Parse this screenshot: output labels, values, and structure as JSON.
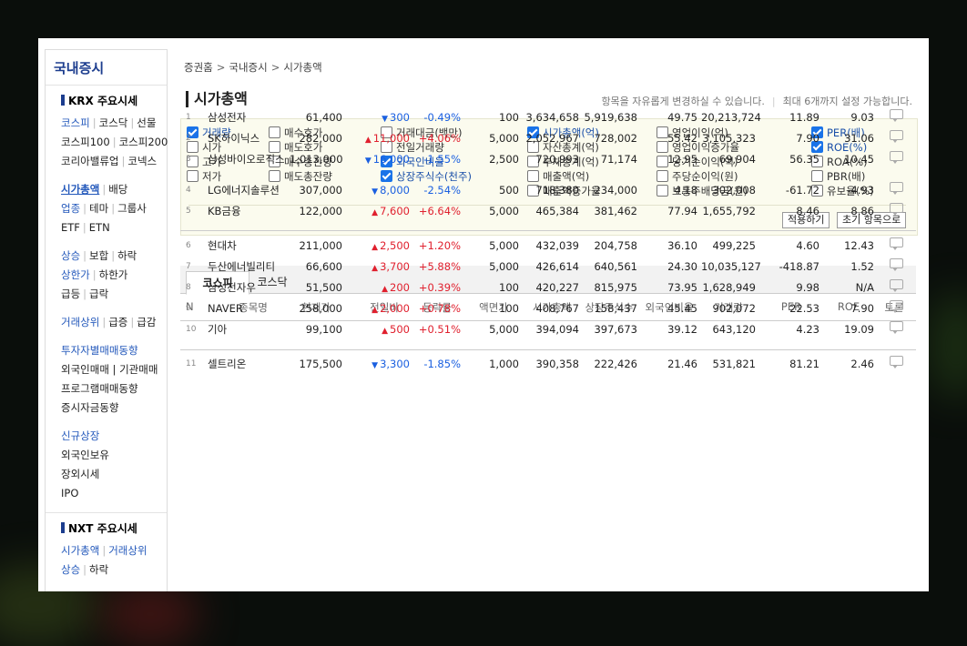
{
  "sidebar": {
    "title": "국내증시",
    "krx_head": "KRX 주요시세",
    "krx_rows": [
      [
        "코스피",
        "코스닥",
        "선물"
      ],
      [
        "코스피100",
        "코스피200"
      ],
      [
        "코리아밸류업",
        "코넥스"
      ]
    ],
    "group2": [
      [
        "시가총액",
        "배당"
      ],
      [
        "업종",
        "테마",
        "그룹사"
      ],
      [
        "ETF",
        "ETN"
      ]
    ],
    "group3": [
      [
        "상승",
        "보합",
        "하락"
      ],
      [
        "상한가",
        "하한가"
      ],
      [
        "급등",
        "급락"
      ]
    ],
    "group4": [
      [
        "거래상위",
        "급증",
        "급감"
      ]
    ],
    "group5": [
      "투자자별매매동향",
      "외국인매매 | 기관매매",
      "프로그램매매동향",
      "증시자금동향"
    ],
    "group6": [
      "신규상장",
      "외국인보유",
      "장외시세",
      "IPO"
    ],
    "nxt_head": "NXT 주요시세",
    "nxt_rows": [
      [
        "시가총액",
        "거래상위"
      ],
      [
        "상승",
        "하락"
      ]
    ]
  },
  "breadcrumb": [
    "증권홈",
    "국내증시",
    "시가총액"
  ],
  "page_title": "시가총액",
  "note_left": "항목을 자유롭게 변경하실 수 있습니다.",
  "note_right": "최대 6개까지 설정 가능합니다.",
  "options": [
    {
      "label": "거래량",
      "checked": true
    },
    {
      "label": "시가",
      "checked": false
    },
    {
      "label": "고가",
      "checked": false
    },
    {
      "label": "저가",
      "checked": false
    },
    {
      "label": "매수호가",
      "checked": false
    },
    {
      "label": "매도호가",
      "checked": false
    },
    {
      "label": "매수총잔량",
      "checked": false
    },
    {
      "label": "매도총잔량",
      "checked": false
    },
    {
      "label": "거래대금(백만)",
      "checked": false
    },
    {
      "label": "전일거래량",
      "checked": false
    },
    {
      "label": "외국인비율",
      "checked": true
    },
    {
      "label": "상장주식수(천주)",
      "checked": true
    },
    {
      "label": "시가총액(억)",
      "checked": true
    },
    {
      "label": "자산총계(억)",
      "checked": false
    },
    {
      "label": "부채총계(억)",
      "checked": false
    },
    {
      "label": "매출액(억)",
      "checked": false
    },
    {
      "label": "매출액증가율",
      "checked": false
    },
    {
      "label": "영업이익(억)",
      "checked": false
    },
    {
      "label": "영업이익증가율",
      "checked": false
    },
    {
      "label": "당기순이익(억)",
      "checked": false
    },
    {
      "label": "주당순이익(원)",
      "checked": false
    },
    {
      "label": "보통주배당금(원)",
      "checked": false
    },
    {
      "label": "PER(배)",
      "checked": true
    },
    {
      "label": "ROE(%)",
      "checked": true
    },
    {
      "label": "ROA(%)",
      "checked": false
    },
    {
      "label": "PBR(배)",
      "checked": false
    },
    {
      "label": "유보율(%)",
      "checked": false
    }
  ],
  "buttons": {
    "apply": "적용하기",
    "reset": "초기 항목으로"
  },
  "tabs": [
    {
      "label": "코스피",
      "active": true
    },
    {
      "label": "코스닥",
      "active": false
    }
  ],
  "table": {
    "headers": [
      "N",
      "종목명",
      "현재가",
      "전일비",
      "등락률",
      "액면가",
      "시가총액",
      "상장주식수",
      "외국인비율",
      "거래량",
      "PER",
      "ROE",
      "토론"
    ],
    "rows": [
      [
        "1",
        "삼성전자",
        "61,400",
        "down",
        "300",
        "-0.49%",
        "100",
        "3,634,658",
        "5,919,638",
        "49.75",
        "20,213,724",
        "11.89",
        "9.03"
      ],
      [
        "2",
        "SK하이닉스",
        "282,000",
        "up",
        "11,000",
        "+4.06%",
        "5,000",
        "2,052,967",
        "728,002",
        "55.42",
        "3,105,323",
        "7.90",
        "31.06"
      ],
      [
        "3",
        "삼성바이오로직스",
        "1,013,000",
        "down",
        "16,000",
        "-1.55%",
        "2,500",
        "720,993",
        "71,174",
        "12.95",
        "69,904",
        "56.35",
        "10.45"
      ],
      [
        "4",
        "LG에너지솔루션",
        "307,000",
        "down",
        "8,000",
        "-2.54%",
        "500",
        "718,380",
        "234,000",
        "4.18",
        "302,008",
        "-61.72",
        "-4.93"
      ],
      [
        "5",
        "KB금융",
        "122,000",
        "up",
        "7,600",
        "+6.64%",
        "5,000",
        "465,384",
        "381,462",
        "77.94",
        "1,655,792",
        "8.46",
        "8.86"
      ],
      [
        "6",
        "현대차",
        "211,000",
        "up",
        "2,500",
        "+1.20%",
        "5,000",
        "432,039",
        "204,758",
        "36.10",
        "499,225",
        "4.60",
        "12.43"
      ],
      [
        "7",
        "두산에너빌리티",
        "66,600",
        "up",
        "3,700",
        "+5.88%",
        "5,000",
        "426,614",
        "640,561",
        "24.30",
        "10,035,127",
        "-418.87",
        "1.52"
      ],
      [
        "8",
        "삼성전자우",
        "51,500",
        "up",
        "200",
        "+0.39%",
        "100",
        "420,227",
        "815,975",
        "73.95",
        "1,628,949",
        "9.98",
        "N/A"
      ],
      [
        "9",
        "NAVER",
        "258,000",
        "up",
        "2,000",
        "+0.78%",
        "100",
        "408,767",
        "158,437",
        "45.45",
        "902,072",
        "22.53",
        "7.90"
      ],
      [
        "10",
        "기아",
        "99,100",
        "up",
        "500",
        "+0.51%",
        "5,000",
        "394,094",
        "397,673",
        "39.12",
        "643,120",
        "4.23",
        "19.09"
      ],
      [
        "11",
        "셀트리온",
        "175,500",
        "down",
        "3,300",
        "-1.85%",
        "1,000",
        "390,358",
        "222,426",
        "21.46",
        "531,821",
        "81.21",
        "2.46"
      ]
    ]
  },
  "colors": {
    "up": "#e0202e",
    "down": "#1a5fe0",
    "brand": "#1c3d8e",
    "link": "#2459bb"
  }
}
